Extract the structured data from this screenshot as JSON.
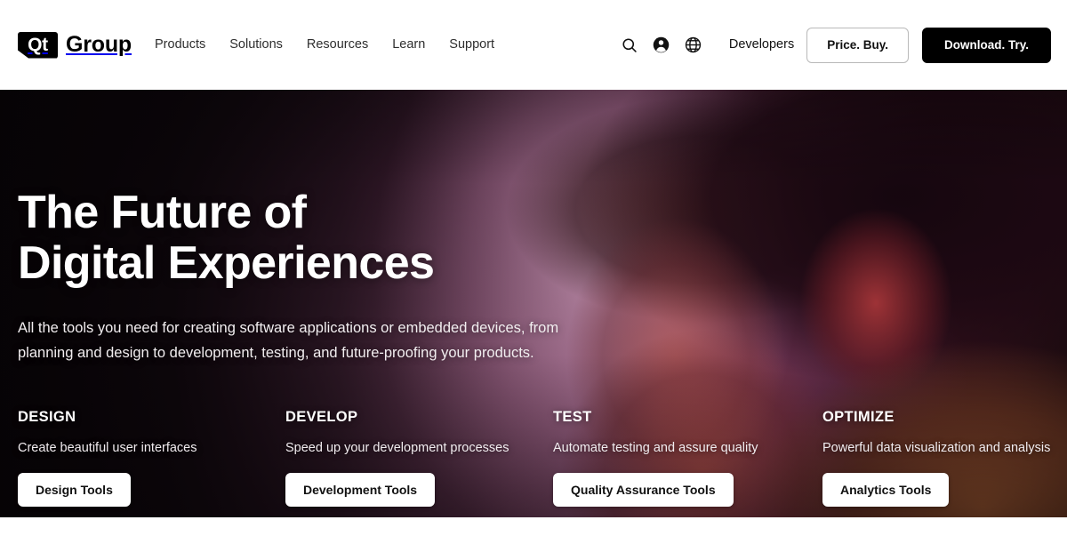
{
  "header": {
    "logo": {
      "mark": "Qt",
      "name": "Group"
    },
    "nav": [
      {
        "label": "Products"
      },
      {
        "label": "Solutions"
      },
      {
        "label": "Resources"
      },
      {
        "label": "Learn"
      },
      {
        "label": "Support"
      }
    ],
    "icons": [
      {
        "name": "search-icon",
        "label": "Search"
      },
      {
        "name": "account-icon",
        "label": "Account"
      },
      {
        "name": "globe-icon",
        "label": "Language"
      }
    ],
    "developers_link": "Developers",
    "price_buy_label": "Price. Buy.",
    "download_try_label": "Download. Try."
  },
  "hero": {
    "title": "The Future of\nDigital Experiences",
    "title_line1": "The Future of",
    "title_line2": "Digital Experiences",
    "subtitle": "All the tools you need for creating software applications or embedded devices, from planning and design to development, testing, and future-proofing your products.",
    "pillars": [
      {
        "title": "DESIGN",
        "desc": "Create beautiful user interfaces",
        "button": "Design Tools"
      },
      {
        "title": "DEVELOP",
        "desc": "Speed up your development processes",
        "button": "Development Tools"
      },
      {
        "title": "TEST",
        "desc": "Automate testing and assure quality",
        "button": "Quality Assurance Tools"
      },
      {
        "title": "OPTIMIZE",
        "desc": "Powerful data visualization and analysis",
        "button": "Analytics Tools"
      }
    ]
  },
  "colors": {
    "header_bg": "#ffffff",
    "text_dark": "#111111",
    "nav_link": "#2e2e2e",
    "button_solid_bg": "#000000",
    "button_solid_text": "#ffffff",
    "button_outline_border": "#b9b9b9",
    "hero_text": "#ffffff",
    "hero_accent_pink": "#b0688f",
    "hero_dark": "#140a11",
    "hero_wall_pink": "#dea6c8",
    "hero_skin_warm": "#96543 0"
  }
}
